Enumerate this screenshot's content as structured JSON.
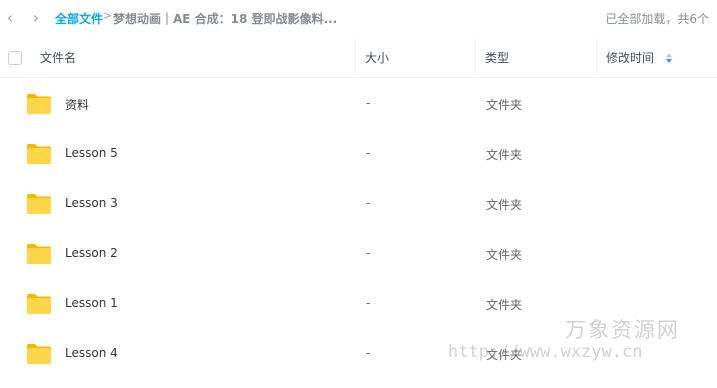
{
  "breadcrumb": {
    "root": "全部文件",
    "separator": ">",
    "path": "梦想动画｜AE 合成：18 登即战影像料..."
  },
  "status": "已全部加载，共6个",
  "columns": {
    "name": "文件名",
    "size": "大小",
    "type": "类型",
    "modified": "修改时间"
  },
  "files": [
    {
      "name": "资料",
      "size": "-",
      "type": "文件夹",
      "icon": "folder-icon"
    },
    {
      "name": "Lesson 5",
      "size": "-",
      "type": "文件夹",
      "icon": "folder-icon"
    },
    {
      "name": "Lesson 3",
      "size": "-",
      "type": "文件夹",
      "icon": "folder-icon"
    },
    {
      "name": "Lesson 2",
      "size": "-",
      "type": "文件夹",
      "icon": "folder-icon"
    },
    {
      "name": "Lesson 1",
      "size": "-",
      "type": "文件夹",
      "icon": "folder-icon"
    },
    {
      "name": "Lesson 4",
      "size": "-",
      "type": "文件夹",
      "icon": "folder-icon"
    }
  ],
  "watermark": {
    "name": "万象资源网",
    "url": "http://www.wxzyw.cn"
  },
  "colors": {
    "accent": "#06a7ff",
    "folder": "#ffca28",
    "muted": "#878c94"
  }
}
